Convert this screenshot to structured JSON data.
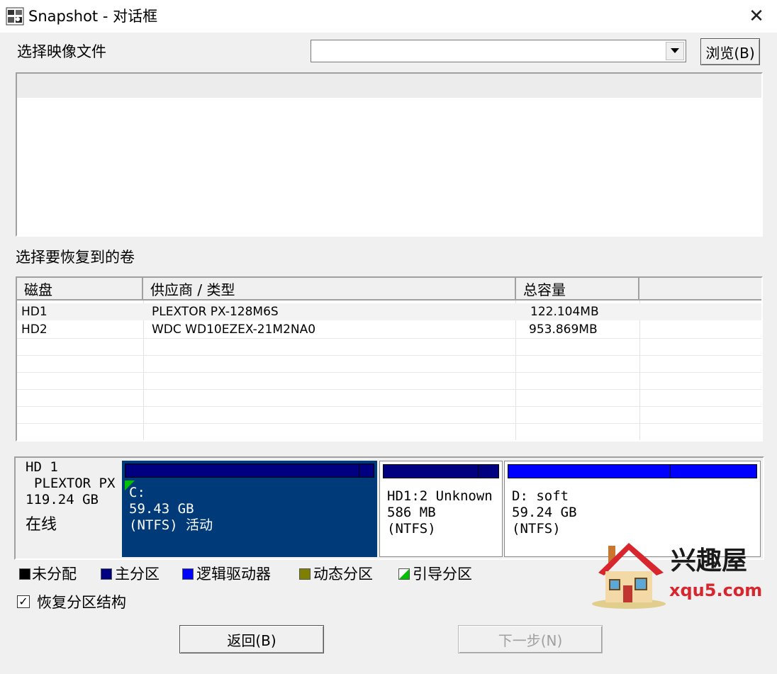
{
  "window": {
    "title": "Snapshot - 对话框"
  },
  "image_file": {
    "label": "选择映像文件",
    "value": "",
    "browse_label": "浏览(B)"
  },
  "volume_section": {
    "label": "选择要恢复到的卷"
  },
  "disk_table": {
    "columns": [
      "磁盘",
      "供应商 / 类型",
      "总容量"
    ],
    "rows": [
      {
        "disk": "HD1",
        "vendor": "PLEXTOR PX-128M6S",
        "capacity": "122.104MB"
      },
      {
        "disk": "HD2",
        "vendor": "WDC WD10EZEX-21M2NA0",
        "capacity": "953.869MB"
      }
    ]
  },
  "disk_map": {
    "disk_info": {
      "line1": "HD 1",
      "line2": "PLEXTOR PX",
      "line3": "119.24 GB",
      "status": "在线"
    },
    "partitions": [
      {
        "line1": "C:",
        "line2": "59.43 GB",
        "line3": "(NTFS) 活动",
        "selected": true,
        "type": "primary",
        "used_fraction": 0.94
      },
      {
        "line1": "HD1:2 Unknown",
        "line2": "586 MB",
        "line3": "(NTFS)",
        "selected": false,
        "type": "primary",
        "used_fraction": 0.82
      },
      {
        "line1": "D: soft",
        "line2": "59.24 GB",
        "line3": "(NTFS)",
        "selected": false,
        "type": "logical",
        "used_fraction": 0.65
      }
    ]
  },
  "legend": [
    {
      "label": "未分配",
      "color": "#000000"
    },
    {
      "label": "主分区",
      "color": "#000080"
    },
    {
      "label": "逻辑驱动器",
      "color": "#0000ff"
    },
    {
      "label": "动态分区",
      "color": "#808000"
    },
    {
      "label": "引导分区",
      "color": "#00c000"
    }
  ],
  "restore_structure": {
    "label": "恢复分区结构",
    "checked": true,
    "mark": "✓"
  },
  "buttons": {
    "back": "返回(B)",
    "next": "下一步(N)"
  },
  "watermark": {
    "brand": "兴趣屋",
    "url": "xqu5.com"
  },
  "colors": {
    "primary": "#000080",
    "logical": "#0000ff",
    "selected_partition_bg": "#003a78"
  }
}
